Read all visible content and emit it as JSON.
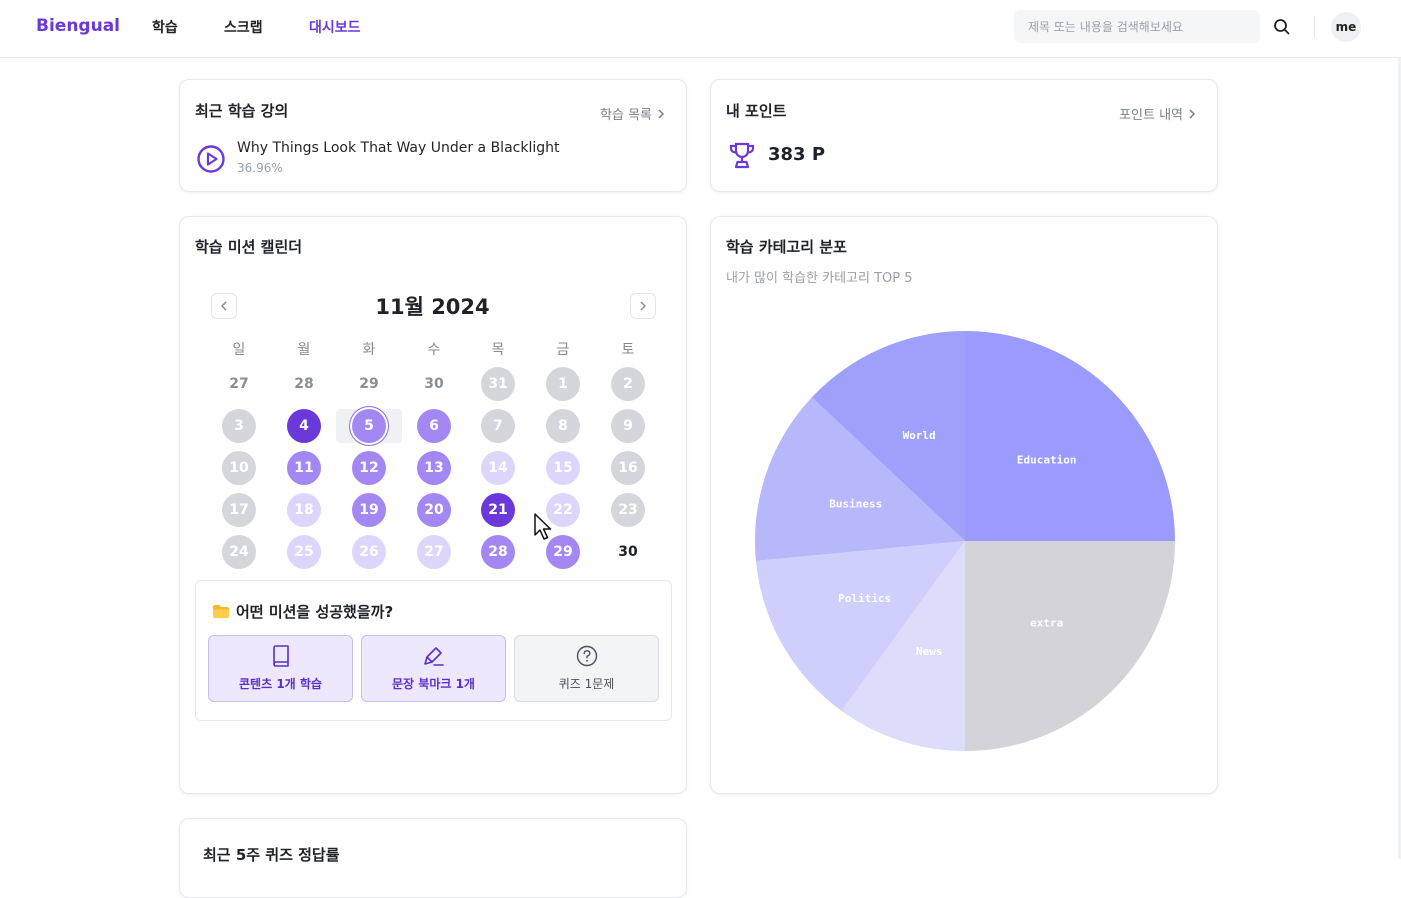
{
  "header": {
    "logo": "Biengual",
    "nav": [
      "학습",
      "스크랩",
      "대시보드"
    ],
    "search_placeholder": "제목 또는 내용을 검색해보세요",
    "avatar": "me"
  },
  "recent": {
    "title": "최근 학습 강의",
    "link": "학습 목록",
    "lecture_title": "Why Things Look That Way Under a Blacklight",
    "progress": "36.96%"
  },
  "points": {
    "title": "내 포인트",
    "link": "포인트 내역",
    "value": "383 P"
  },
  "calendar": {
    "title": "학습 미션 캘린더",
    "month_label": "11월 2024",
    "weekdays": [
      "일",
      "월",
      "화",
      "수",
      "목",
      "금",
      "토"
    ],
    "weeks": [
      [
        {
          "d": "27",
          "s": "prev"
        },
        {
          "d": "28",
          "s": "prev"
        },
        {
          "d": "29",
          "s": "prev"
        },
        {
          "d": "30",
          "s": "prev"
        },
        {
          "d": "31",
          "s": "none"
        },
        {
          "d": "1",
          "s": "none"
        },
        {
          "d": "2",
          "s": "none"
        }
      ],
      [
        {
          "d": "3",
          "s": "none"
        },
        {
          "d": "4",
          "s": "l3"
        },
        {
          "d": "5",
          "s": "today"
        },
        {
          "d": "6",
          "s": "l2"
        },
        {
          "d": "7",
          "s": "none"
        },
        {
          "d": "8",
          "s": "none"
        },
        {
          "d": "9",
          "s": "none"
        }
      ],
      [
        {
          "d": "10",
          "s": "none"
        },
        {
          "d": "11",
          "s": "l2"
        },
        {
          "d": "12",
          "s": "l2"
        },
        {
          "d": "13",
          "s": "l2"
        },
        {
          "d": "14",
          "s": "l1"
        },
        {
          "d": "15",
          "s": "l1"
        },
        {
          "d": "16",
          "s": "none"
        }
      ],
      [
        {
          "d": "17",
          "s": "none"
        },
        {
          "d": "18",
          "s": "l1"
        },
        {
          "d": "19",
          "s": "l2"
        },
        {
          "d": "20",
          "s": "l2"
        },
        {
          "d": "21",
          "s": "l3"
        },
        {
          "d": "22",
          "s": "l1"
        },
        {
          "d": "23",
          "s": "none"
        }
      ],
      [
        {
          "d": "24",
          "s": "none"
        },
        {
          "d": "25",
          "s": "l1"
        },
        {
          "d": "26",
          "s": "l1"
        },
        {
          "d": "27",
          "s": "l1"
        },
        {
          "d": "28",
          "s": "l2"
        },
        {
          "d": "29",
          "s": "l2"
        },
        {
          "d": "30",
          "s": "plain"
        }
      ]
    ],
    "mission_question": "어떤 미션을 성공했을까?",
    "missions": [
      {
        "label": "콘텐츠 1개 학습",
        "icon": "book-icon",
        "done": true
      },
      {
        "label": "문장 북마크 1개",
        "icon": "highlighter-icon",
        "done": true
      },
      {
        "label": "퀴즈 1문제",
        "icon": "question-circle-icon",
        "done": false
      }
    ]
  },
  "category_chart": {
    "title": "학습 카테고리 분포",
    "subtitle": "내가 많이 학습한 카테고리 TOP 5"
  },
  "chart_data": {
    "type": "pie",
    "title": "학습 카테고리 분포",
    "slices": [
      {
        "label": "Education",
        "value": 25.0,
        "color": "#9b9bff"
      },
      {
        "label": "extra",
        "value": 25.0,
        "color": "#d3d3d8"
      },
      {
        "label": "News",
        "value": 10.0,
        "color": "#dcdcfb"
      },
      {
        "label": "Politics",
        "value": 13.5,
        "color": "#cfcffb"
      },
      {
        "label": "Business",
        "value": 13.5,
        "color": "#b7b7fc"
      },
      {
        "label": "World",
        "value": 13.0,
        "color": "#9f9ffc"
      }
    ]
  },
  "quiz": {
    "title": "최근 5주 퀴즈 정답률"
  }
}
